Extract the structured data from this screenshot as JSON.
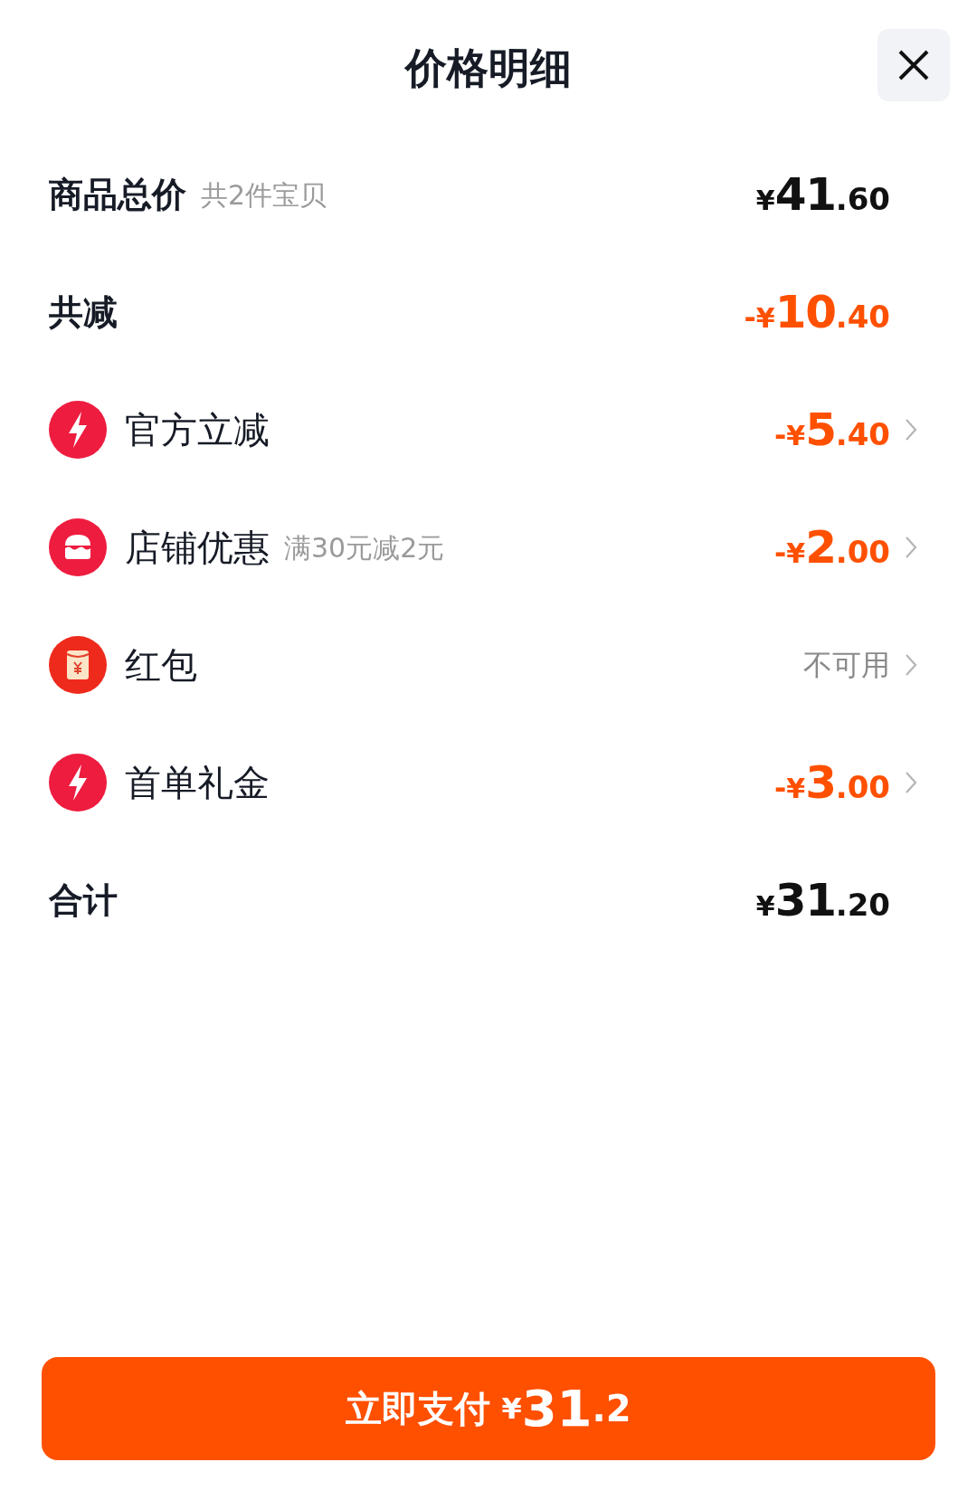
{
  "title": "价格明细",
  "rows": [
    {
      "kind": "sum",
      "label": "商品总价",
      "note": "共2件宝贝",
      "price": {
        "currency": "¥",
        "integer": "41",
        "decimal": ".60"
      }
    },
    {
      "kind": "reduction",
      "label": "共减",
      "price": {
        "sign": "-",
        "currency": "¥",
        "integer": "10",
        "decimal": ".40"
      }
    },
    {
      "kind": "flash",
      "label": "官方立减",
      "price": {
        "sign": "-",
        "currency": "¥",
        "integer": "5",
        "decimal": ".40"
      }
    },
    {
      "kind": "shop",
      "label": "店铺优惠",
      "note": "满30元减2元",
      "price": {
        "sign": "-",
        "currency": "¥",
        "integer": "2",
        "decimal": ".00"
      }
    },
    {
      "kind": "packet",
      "label": "红包",
      "status": "不可用"
    },
    {
      "kind": "flash",
      "label": "首单礼金",
      "price": {
        "sign": "-",
        "currency": "¥",
        "integer": "3",
        "decimal": ".00"
      }
    },
    {
      "kind": "sum",
      "label": "合计",
      "price": {
        "currency": "¥",
        "integer": "31",
        "decimal": ".20"
      }
    }
  ],
  "pay_button": {
    "label": "立即支付",
    "currency": "¥",
    "integer": "31",
    "decimal": ".2"
  }
}
